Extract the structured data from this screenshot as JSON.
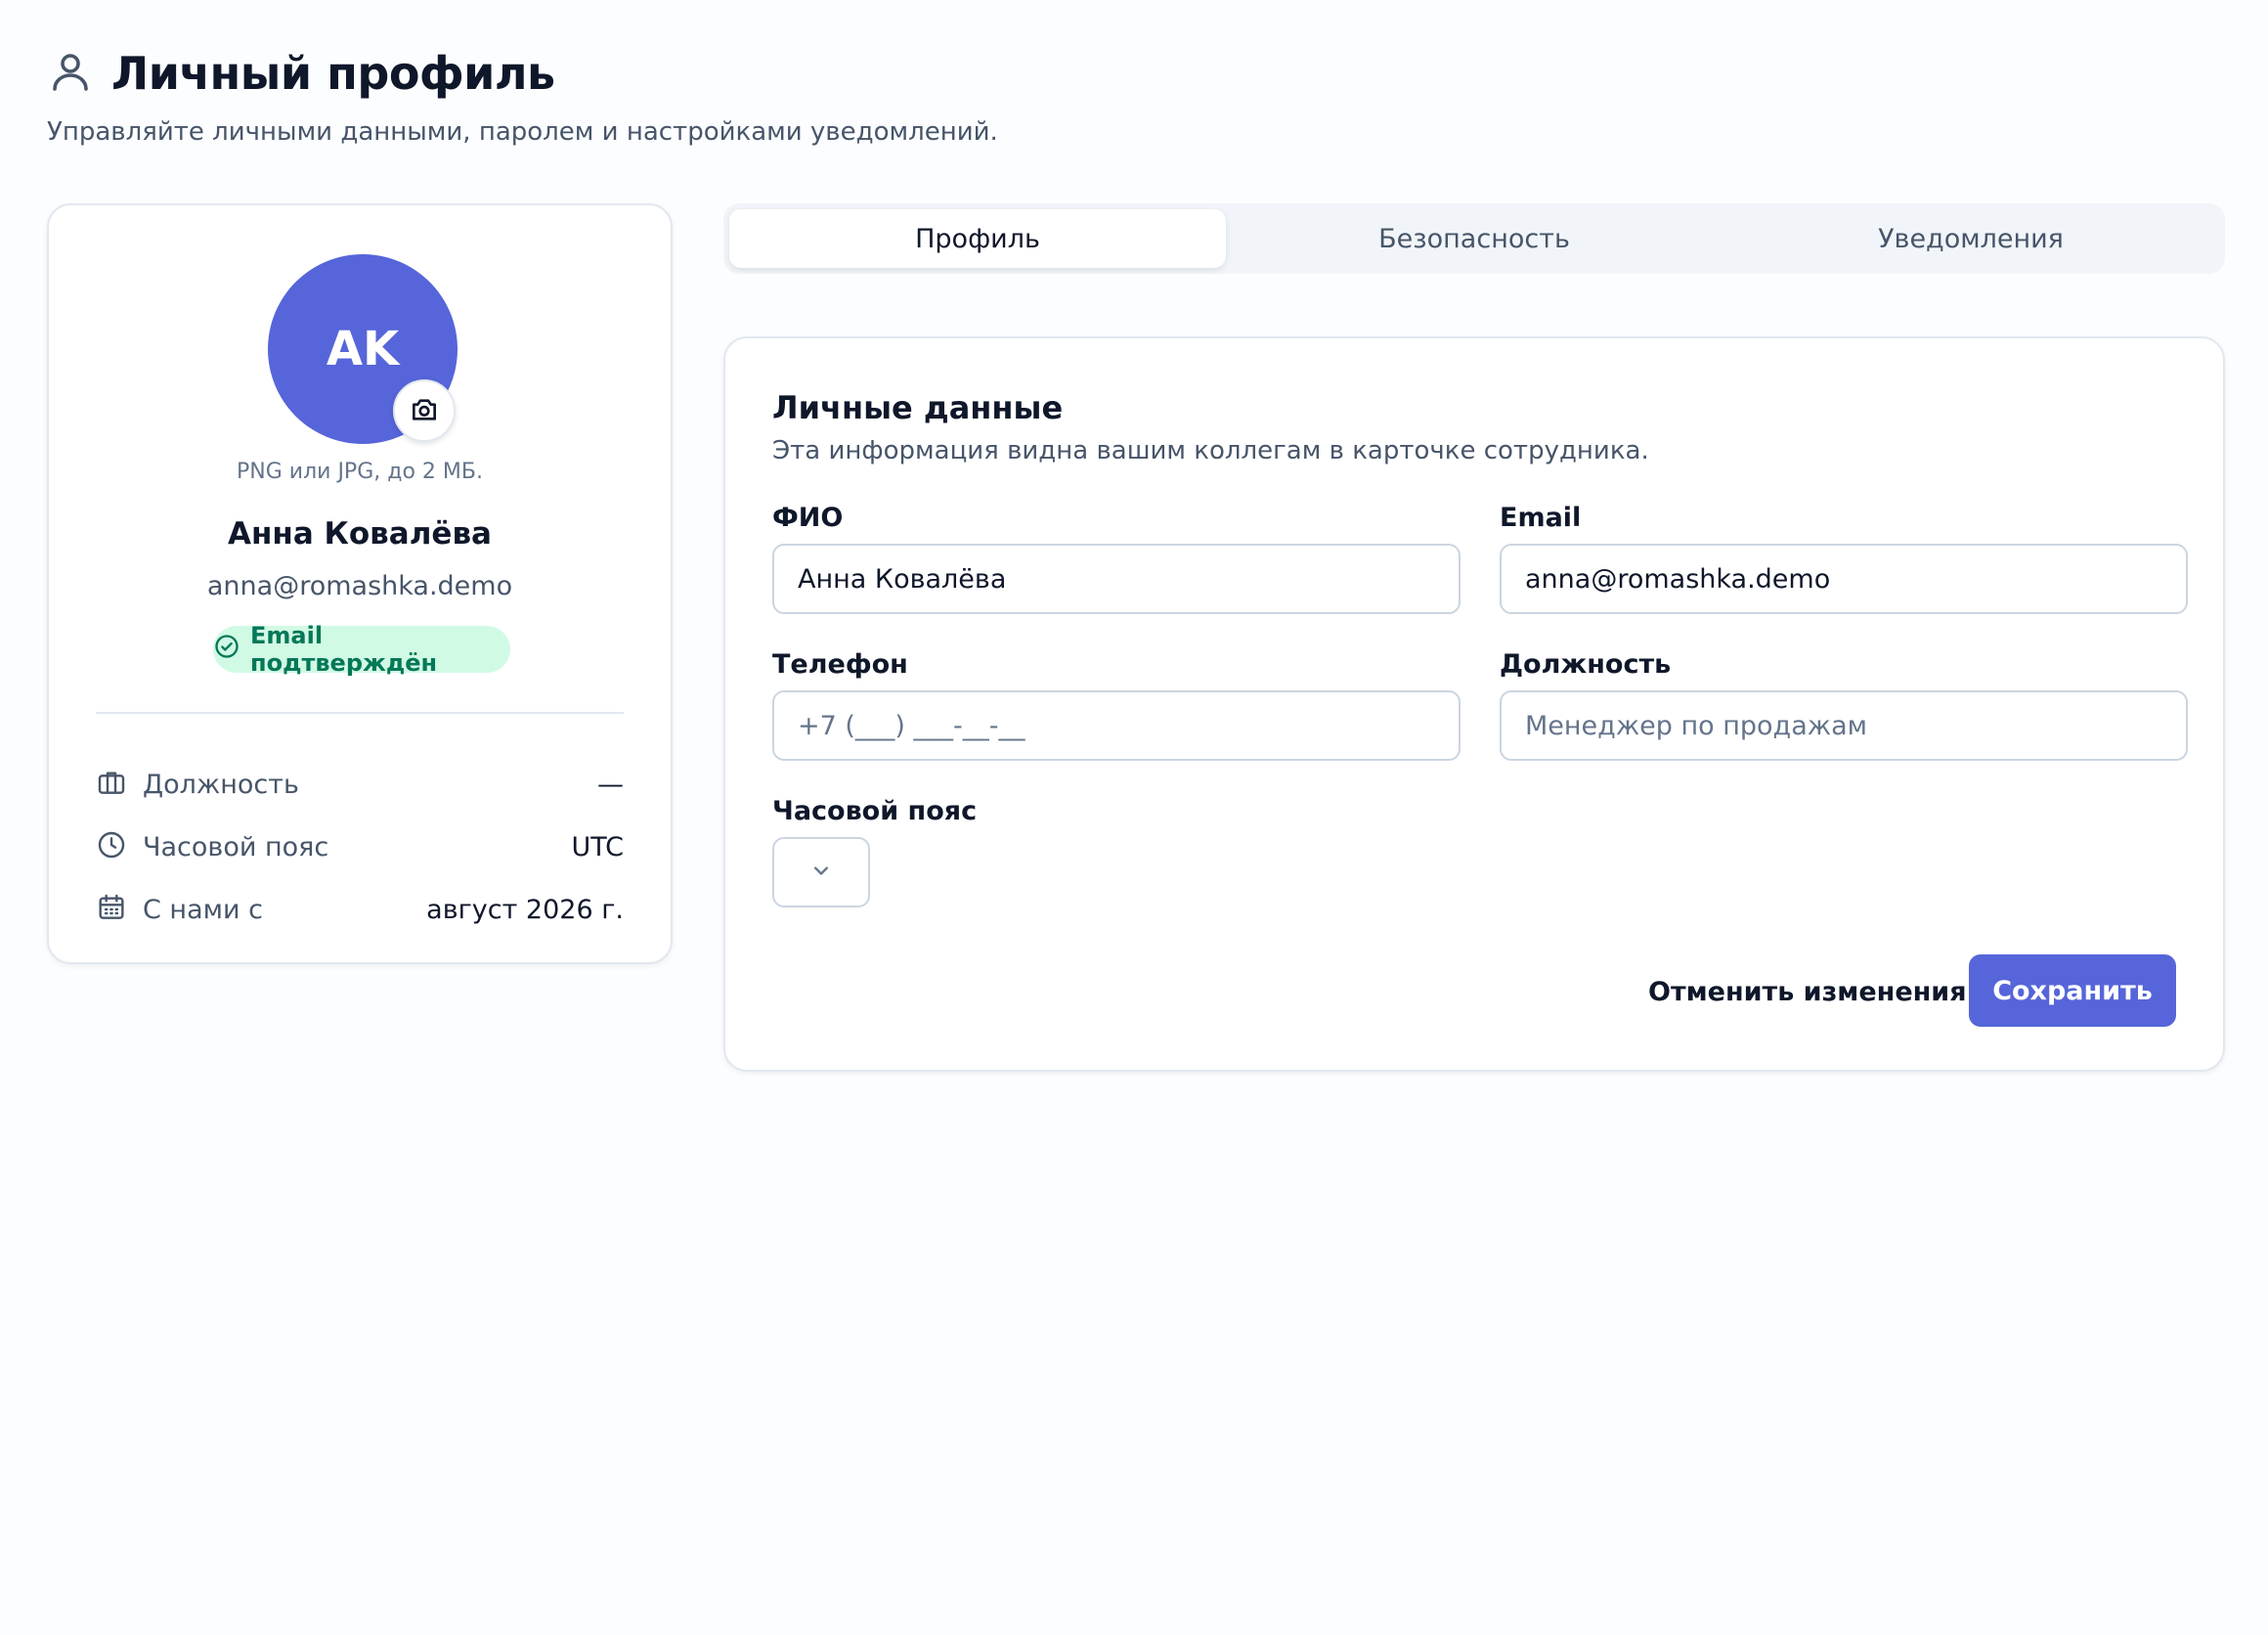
{
  "header": {
    "title": "Личный профиль",
    "subtitle": "Управляйте личными данными, паролем и настройками уведомлений.",
    "icon": "user-icon"
  },
  "profile_card": {
    "avatar_initials": "AK",
    "avatar_color": "#5665d9",
    "upload_hint": "PNG или JPG, до 2 МБ.",
    "name": "Анна Ковалёва",
    "email": "anna@romashka.demo",
    "verified_badge": "Email подтверждён",
    "info": [
      {
        "icon": "briefcase-icon",
        "label": "Должность",
        "value": "—"
      },
      {
        "icon": "clock-icon",
        "label": "Часовой пояс",
        "value": "UTC"
      },
      {
        "icon": "calendar-icon",
        "label": "С нами с",
        "value": "август 2026 г."
      }
    ]
  },
  "tabs": [
    {
      "label": "Профиль",
      "active": true
    },
    {
      "label": "Безопасность",
      "active": false
    },
    {
      "label": "Уведомления",
      "active": false
    }
  ],
  "form": {
    "title": "Личные данные",
    "description": "Эта информация видна вашим коллегам в карточке сотрудника.",
    "fields": {
      "fio": {
        "label": "ФИО",
        "value": "Анна Ковалёва",
        "placeholder": ""
      },
      "email": {
        "label": "Email",
        "value": "anna@romashka.demo",
        "placeholder": ""
      },
      "phone": {
        "label": "Телефон",
        "value": "",
        "placeholder": "+7 (___) ___-__-__"
      },
      "position": {
        "label": "Должность",
        "value": "",
        "placeholder": "Менеджер по продажам"
      },
      "timezone": {
        "label": "Часовой пояс",
        "value": ""
      }
    },
    "cancel_label": "Отменить изменения",
    "save_label": "Сохранить"
  },
  "colors": {
    "accent": "#5665d9",
    "success_bg": "#d1fae5",
    "success_text": "#047857"
  }
}
